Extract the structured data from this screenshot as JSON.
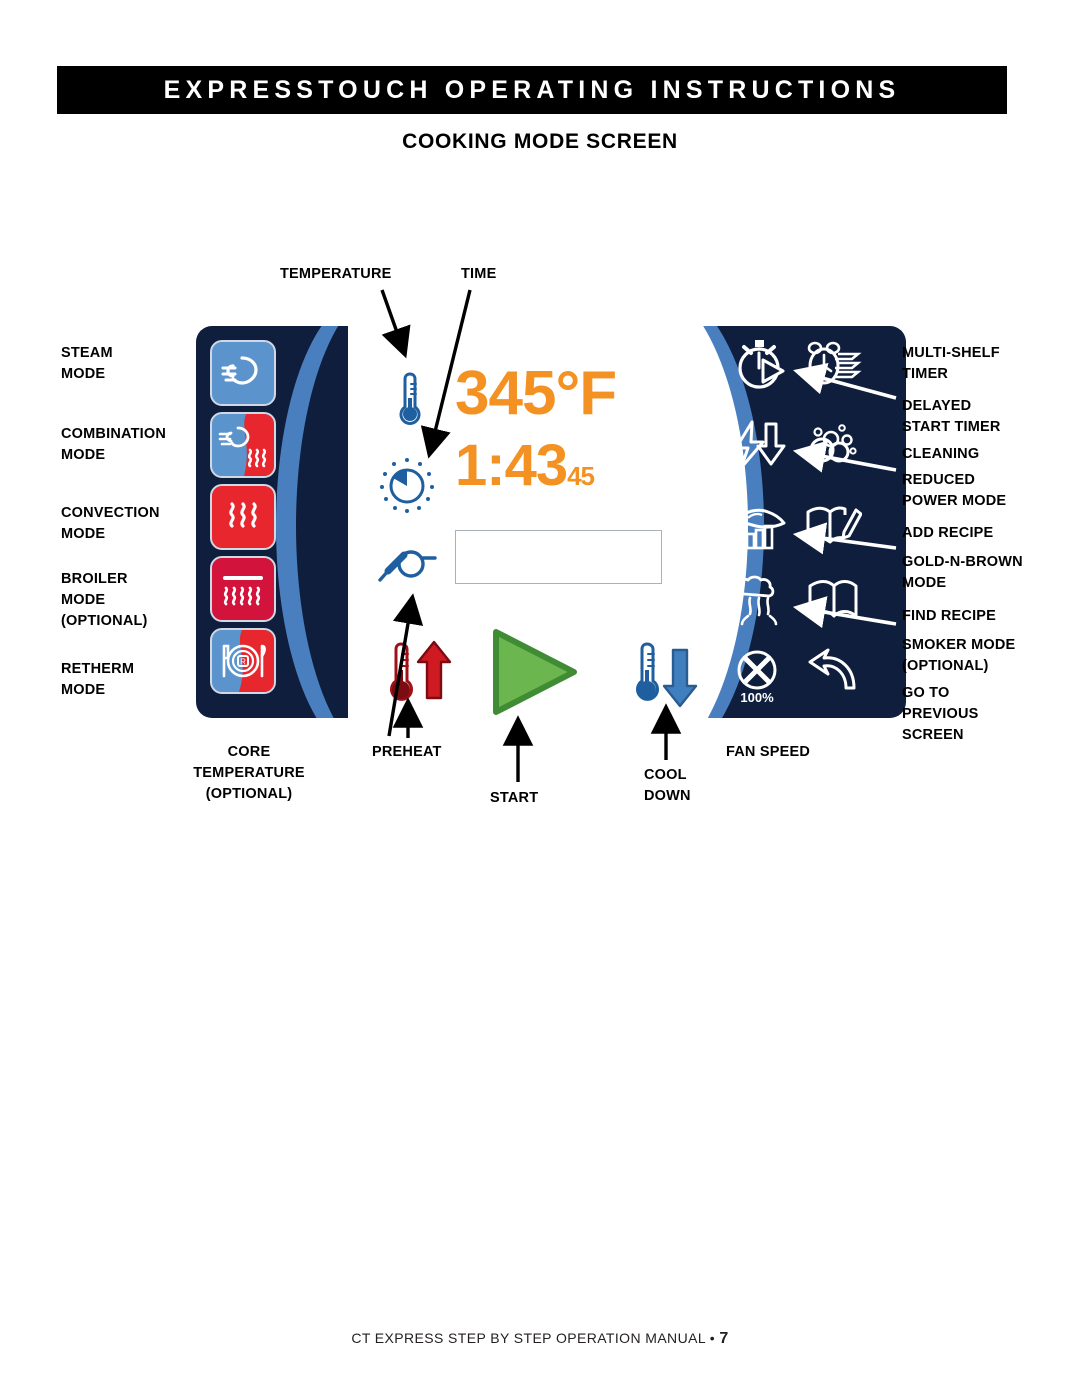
{
  "header": {
    "title": "EXPRESSTOUCH OPERATING INSTRUCTIONS",
    "subtitle": "COOKING MODE SCREEN"
  },
  "readout": {
    "temperature": "345°F",
    "time": "1:43",
    "time_seconds": "45"
  },
  "top_labels": [
    {
      "name": "temperature",
      "text": "TEMPERATURE"
    },
    {
      "name": "time",
      "text": "TIME"
    }
  ],
  "left_labels": [
    {
      "name": "steam-mode",
      "text": "STEAM\nMODE"
    },
    {
      "name": "combination-mode",
      "text": "COMBINATION\nMODE"
    },
    {
      "name": "convection-mode",
      "text": "CONVECTION\nMODE"
    },
    {
      "name": "broiler-mode",
      "text": "BROILER\nMODE\n(OPTIONAL)"
    },
    {
      "name": "retherm-mode",
      "text": "RETHERM\nMODE"
    }
  ],
  "right_labels": [
    {
      "name": "multi-shelf-timer",
      "text": "MULTI-SHELF\nTIMER"
    },
    {
      "name": "delayed-start-timer",
      "text": "DELAYED\nSTART TIMER"
    },
    {
      "name": "cleaning",
      "text": "CLEANING"
    },
    {
      "name": "reduced-power-mode",
      "text": "REDUCED\nPOWER MODE"
    },
    {
      "name": "add-recipe",
      "text": "ADD RECIPE"
    },
    {
      "name": "gold-n-brown-mode",
      "text": "GOLD-N-BROWN\nMODE"
    },
    {
      "name": "find-recipe",
      "text": "FIND RECIPE"
    },
    {
      "name": "smoker-mode",
      "text": "SMOKER MODE\n(OPTIONAL)"
    },
    {
      "name": "go-to-previous-screen",
      "text": "GO TO\nPREVIOUS\nSCREEN"
    }
  ],
  "bottom_labels": [
    {
      "name": "core-temperature",
      "text": "CORE\nTEMPERATURE\n(OPTIONAL)"
    },
    {
      "name": "preheat",
      "text": "PREHEAT"
    },
    {
      "name": "start",
      "text": "START"
    },
    {
      "name": "cool-down",
      "text": "COOL\nDOWN"
    },
    {
      "name": "fan-speed",
      "text": "FAN SPEED"
    }
  ],
  "fan_speed_value": "100%",
  "footer": {
    "text": "CT EXPRESS STEP BY STEP OPERATION MANUAL • ",
    "page": "7"
  },
  "colors": {
    "navy": "#0e1e3c",
    "accent_blue": "#4a7fbf",
    "orange": "#f39222",
    "red": "#e8262d",
    "crimson": "#d2143c",
    "green": "#5aaf43",
    "icon_blue": "#1f5fa0"
  }
}
